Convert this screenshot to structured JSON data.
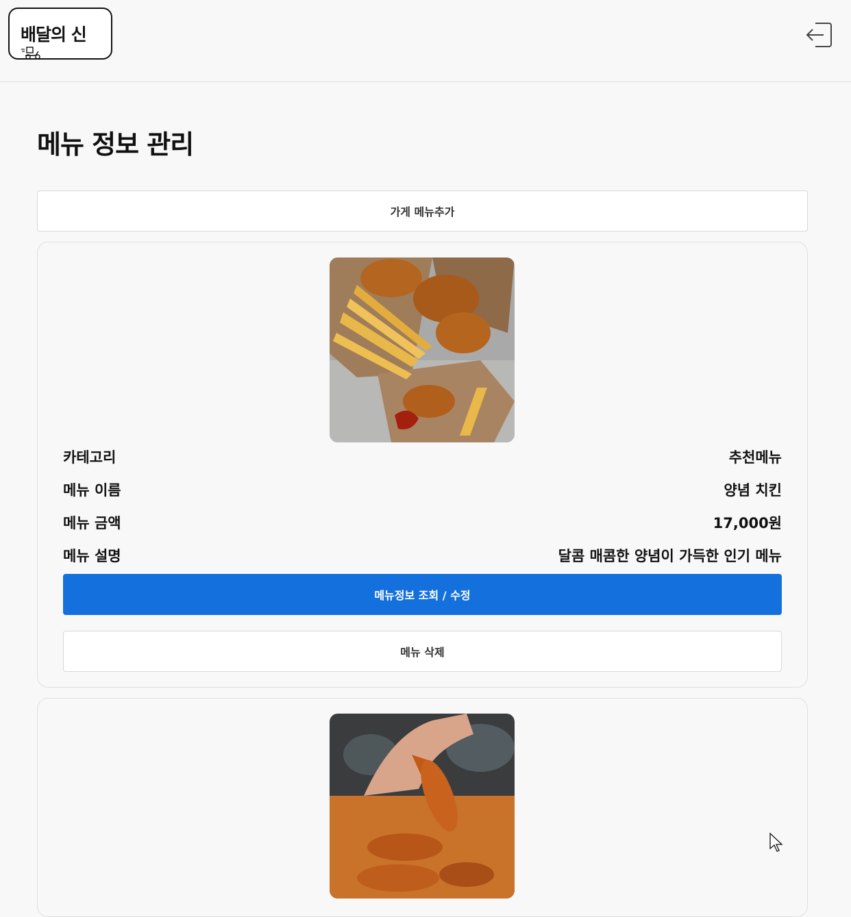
{
  "header": {
    "logo_text": "배달의 신",
    "logo_icon": "scooter-icon",
    "logout_icon": "logout-icon"
  },
  "page": {
    "title": "메뉴 정보 관리",
    "add_menu_label": "가게 메뉴추가"
  },
  "menu_items": [
    {
      "image": "fried-chicken-fries-photo",
      "fields": [
        {
          "label": "카테고리",
          "value": "추천메뉴"
        },
        {
          "label": "메뉴 이름",
          "value": "양념 치킨"
        },
        {
          "label": "메뉴 금액",
          "value": "17,000원"
        },
        {
          "label": "메뉴 설명",
          "value": "달콤 매콤한 양념이 가득한 인기 메뉴"
        }
      ],
      "edit_label": "메뉴정보 조회 / 수정",
      "delete_label": "메뉴 삭제"
    },
    {
      "image": "chicken-tenders-photo"
    }
  ],
  "colors": {
    "primary": "#1470dc",
    "background": "#f8f8f8",
    "border": "#d8d8d8"
  }
}
